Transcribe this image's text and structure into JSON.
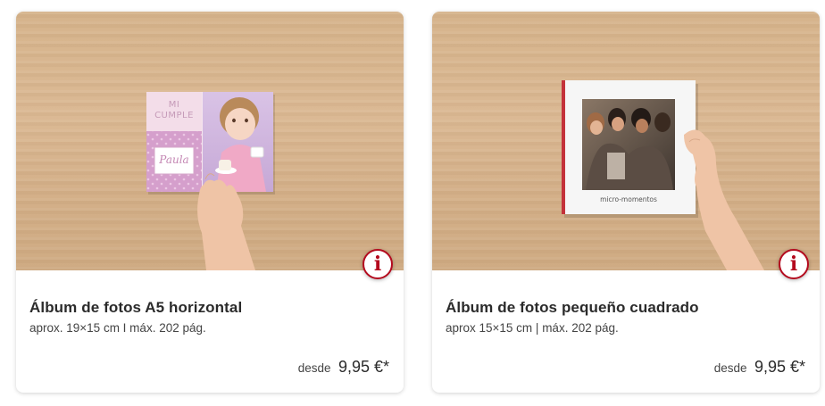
{
  "products": [
    {
      "title": "Álbum de fotos A5 horizontal",
      "subtitle": "aprox. 19×15 cm I máx. 202 pág.",
      "price_prefix": "desde",
      "price": "9,95 €*",
      "cover_texts": [
        "MI",
        "CUMPLE",
        "Paula"
      ],
      "info_icon": "i"
    },
    {
      "title": "Álbum de fotos pequeño cuadrado",
      "subtitle": "aprox 15×15 cm | máx. 202 pág.",
      "price_prefix": "desde",
      "price": "9,95 €*",
      "cover_texts": [
        "micro-momentos"
      ],
      "info_icon": "i"
    }
  ],
  "colors": {
    "accent": "#b40a1e",
    "wood": "#d6b48c",
    "cover_pink": "#f0dde8",
    "cover_polka": "#d59fcc"
  }
}
